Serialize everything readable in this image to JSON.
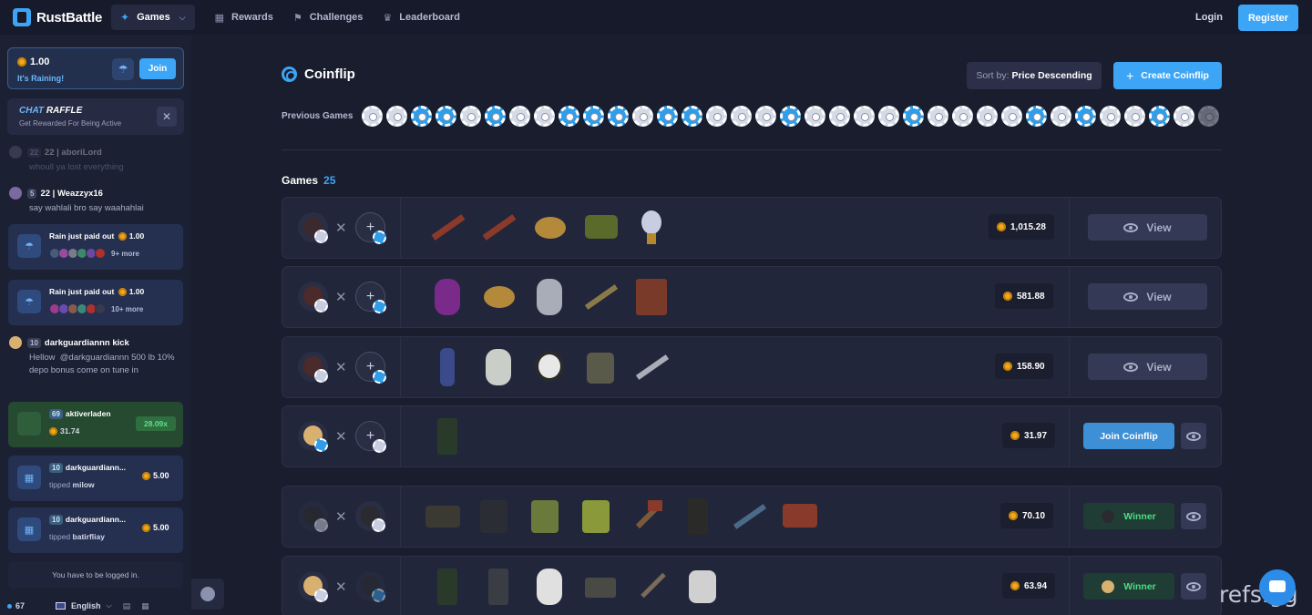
{
  "brand": {
    "name": "RustBattle"
  },
  "nav": {
    "games": "Games",
    "rewards": "Rewards",
    "challenges": "Challenges",
    "leaderboard": "Leaderboard",
    "login": "Login",
    "register": "Register"
  },
  "sidebar": {
    "rain": {
      "amount": "1.00",
      "subtitle": "It's Raining!",
      "join": "Join"
    },
    "raffle": {
      "title_a": "CHAT",
      "title_b": "RAFFLE",
      "subtitle": "Get Rewarded For Being Active"
    },
    "chat": [
      {
        "level": "22",
        "user": "22 | aboriLord",
        "text": "whoull ya lost everything"
      },
      {
        "level": "5",
        "user": "22 | Weazzyx16",
        "text": "say wahlali bro say waahahlai"
      }
    ],
    "rain_cards": [
      {
        "label": "Rain just paid out",
        "amount": "1.00",
        "more": "9+ more"
      },
      {
        "label": "Rain just paid out",
        "amount": "1.00",
        "more": "10+ more"
      }
    ],
    "chat2": {
      "level": "10",
      "user": "darkguardiannn kick",
      "text": "Hellow  @darkguardiannn 500 lb 10% depo bonus come on tune in"
    },
    "win_card": {
      "level": "69",
      "user": "aktiverladen",
      "amount": "31.74",
      "multiplier": "28.09x"
    },
    "tip_cards": [
      {
        "level": "10",
        "user": "darkguardiann...",
        "tipped": "tipped",
        "target": "milow",
        "amount": "5.00"
      },
      {
        "level": "10",
        "user": "darkguardiann...",
        "tipped": "tipped",
        "target": "batirfliay",
        "amount": "5.00"
      }
    ],
    "logged_notice": "You have to be logged in.",
    "online": "67",
    "language": "English"
  },
  "main": {
    "title": "Coinflip",
    "sort_prefix": "Sort by:",
    "sort_value": "Price Descending",
    "create": "Create Coinflip",
    "previous_label": "Previous Games",
    "previous": [
      "w",
      "w",
      "b",
      "b",
      "w",
      "b",
      "w",
      "w",
      "b",
      "b",
      "b",
      "w",
      "b",
      "b",
      "w",
      "w",
      "w",
      "b",
      "w",
      "w",
      "w",
      "w",
      "b",
      "w",
      "w",
      "w",
      "w",
      "b",
      "w",
      "b",
      "w",
      "w",
      "b",
      "w",
      "w"
    ],
    "games_label": "Games",
    "games_count": "25",
    "games": [
      {
        "price": "1,015.28",
        "action": "view",
        "label": "View"
      },
      {
        "price": "581.88",
        "action": "view",
        "label": "View"
      },
      {
        "price": "158.90",
        "action": "view",
        "label": "View"
      },
      {
        "price": "31.97",
        "action": "join",
        "label": "Join Coinflip"
      },
      {
        "price": "70.10",
        "action": "winner",
        "label": "Winner"
      },
      {
        "price": "63.94",
        "action": "winner",
        "label": "Winner"
      }
    ]
  },
  "watermark": "refs.gg"
}
